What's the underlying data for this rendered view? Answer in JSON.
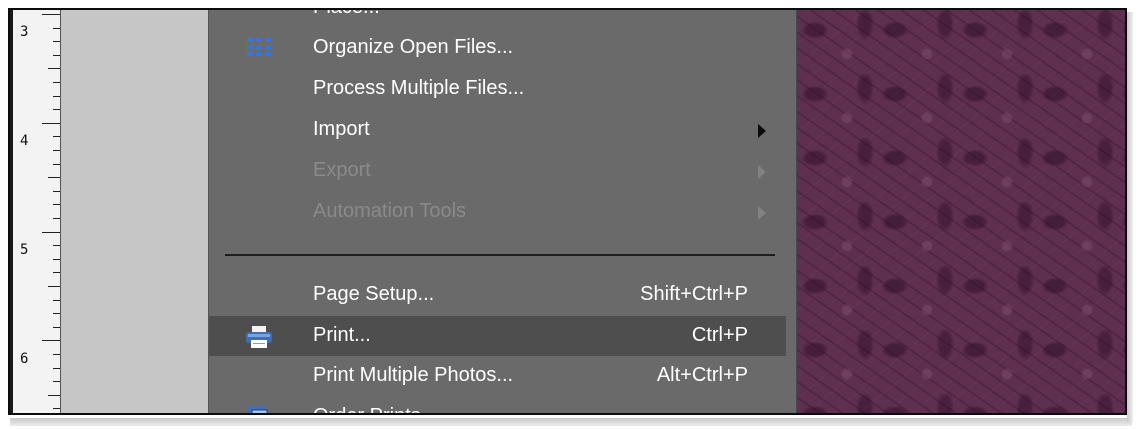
{
  "ruler": {
    "labels": [
      "3",
      "4",
      "5",
      "6"
    ]
  },
  "menu": {
    "items": [
      {
        "label": "Place...",
        "shortcut": "",
        "disabled": false
      },
      {
        "label": "Organize Open Files...",
        "shortcut": "",
        "icon": "grid-icon"
      },
      {
        "label": "Process Multiple Files...",
        "shortcut": ""
      },
      {
        "label": "Import",
        "shortcut": "",
        "submenu": true
      },
      {
        "label": "Export",
        "shortcut": "",
        "submenu": true,
        "disabled": true
      },
      {
        "label": "Automation Tools",
        "shortcut": "",
        "submenu": true,
        "disabled": true
      },
      {
        "label": "Page Setup...",
        "shortcut": "Shift+Ctrl+P"
      },
      {
        "label": "Print...",
        "shortcut": "Ctrl+P",
        "icon": "printer-icon",
        "highlighted": true
      },
      {
        "label": "Print Multiple Photos...",
        "shortcut": "Alt+Ctrl+P"
      },
      {
        "label": "Order Prints",
        "shortcut": "",
        "icon": "order-prints-icon"
      }
    ]
  },
  "colors": {
    "menu_bg": "#6a6a6a",
    "highlight_bg": "#4e4e4e",
    "pattern_bg": "#5f2f50",
    "icon_blue": "#3a74d8"
  }
}
